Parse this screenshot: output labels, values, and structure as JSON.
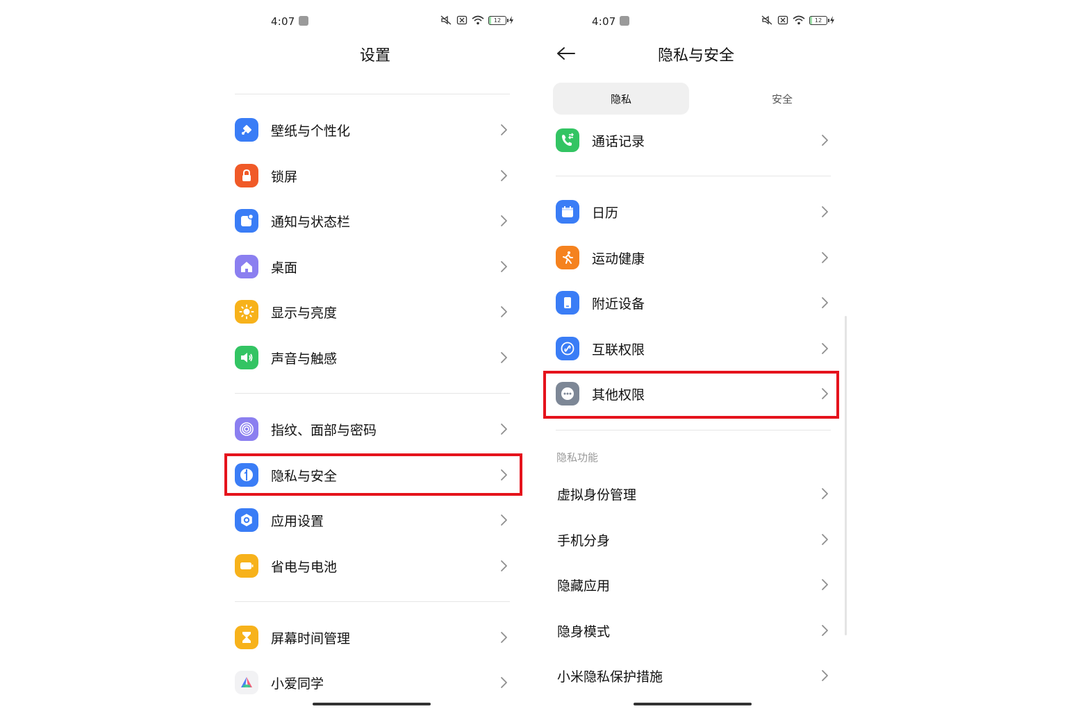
{
  "colors": {
    "highlight": "#e5131c",
    "wallpaper": "#3a7df6",
    "lock": "#f05a28",
    "notify": "#3a7df6",
    "desktop": "#8b7ff0",
    "display": "#f7b21b",
    "sound": "#33c463",
    "fingerprint": "#8b7ff0",
    "privacy": "#3a7df6",
    "apps": "#3a7df6",
    "battery": "#f7b21b",
    "screentime": "#f7b21b",
    "calls": "#33c463",
    "calendar": "#3a7df6",
    "health": "#f5821f",
    "nearby": "#3a7df6",
    "interconnect": "#3a7df6",
    "other": "#7d8796"
  },
  "left": {
    "status": {
      "time": "4:07",
      "battery": "12"
    },
    "title": "设置",
    "items": [
      {
        "label": "壁纸与个性化",
        "icon": "wallpaper-icon"
      },
      {
        "label": "锁屏",
        "icon": "lock-icon"
      },
      {
        "label": "通知与状态栏",
        "icon": "notification-icon"
      },
      {
        "label": "桌面",
        "icon": "home-icon"
      },
      {
        "label": "显示与亮度",
        "icon": "sun-icon"
      },
      {
        "label": "声音与触感",
        "icon": "speaker-icon"
      },
      {
        "label": "指纹、面部与密码",
        "icon": "fingerprint-icon"
      },
      {
        "label": "隐私与安全",
        "icon": "shield-icon"
      },
      {
        "label": "应用设置",
        "icon": "app-settings-icon"
      },
      {
        "label": "省电与电池",
        "icon": "battery-icon"
      },
      {
        "label": "屏幕时间管理",
        "icon": "hourglass-icon"
      },
      {
        "label": "小爱同学",
        "icon": "xiaoai-icon"
      }
    ]
  },
  "right": {
    "status": {
      "time": "4:07",
      "battery": "12"
    },
    "title": "隐私与安全",
    "tabs": [
      {
        "label": "隐私",
        "active": true
      },
      {
        "label": "安全",
        "active": false
      }
    ],
    "items": [
      {
        "label": "通话记录",
        "icon": "phone-icon"
      },
      {
        "label": "日历",
        "icon": "calendar-icon"
      },
      {
        "label": "运动健康",
        "icon": "running-icon"
      },
      {
        "label": "附近设备",
        "icon": "device-icon"
      },
      {
        "label": "互联权限",
        "icon": "link-icon"
      },
      {
        "label": "其他权限",
        "icon": "more-icon"
      }
    ],
    "section_header": "隐私功能",
    "features": [
      {
        "label": "虚拟身份管理"
      },
      {
        "label": "手机分身"
      },
      {
        "label": "隐藏应用"
      },
      {
        "label": "隐身模式"
      },
      {
        "label": "小米隐私保护措施"
      }
    ]
  }
}
